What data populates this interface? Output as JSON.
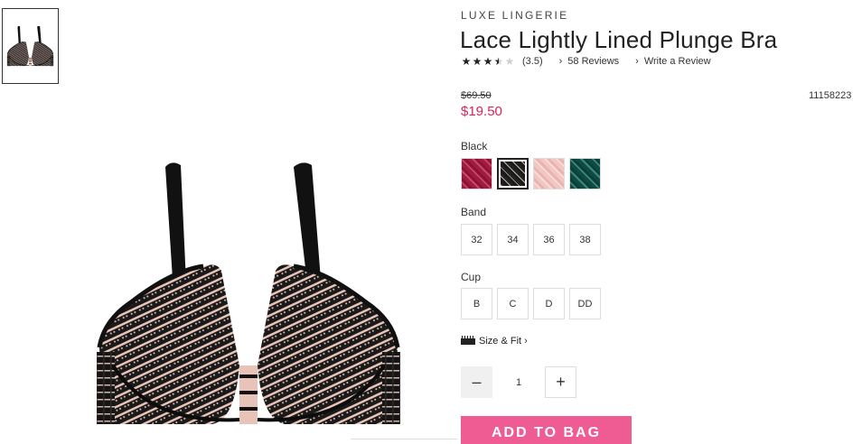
{
  "product": {
    "collection": "LUXE LINGERIE",
    "title": "Lace Lightly Lined Plunge Bra",
    "rating_value": "(3.5)",
    "rating": 3.5,
    "reviews_link": "58 Reviews",
    "write_review_link": "Write a Review",
    "old_price": "$69.50",
    "new_price": "$19.50",
    "sku": "11158223"
  },
  "color": {
    "selected_label": "Black",
    "swatches": [
      "red-lace-swatch",
      "black-lace-swatch",
      "pink-lace-swatch",
      "green-lace-swatch"
    ],
    "colors": {
      "red": "#a31a3f",
      "black": "#1a1a1a",
      "pink": "#f1c6c4",
      "green": "#0f4a43"
    }
  },
  "band": {
    "label": "Band",
    "options": [
      "32",
      "34",
      "36",
      "38"
    ]
  },
  "cup": {
    "label": "Cup",
    "options": [
      "B",
      "C",
      "D",
      "DD"
    ]
  },
  "size_fit": {
    "label": "Size & Fit",
    "icon": "ruler-icon"
  },
  "quantity": {
    "minus": "–",
    "value": "1",
    "plus": "+"
  },
  "cart": {
    "add_label": "ADD TO BAG",
    "accent": "#ef5b93"
  },
  "icons": {
    "star": "star-icon",
    "chevron": "chevron-right-icon"
  },
  "price_color": "#d6245a"
}
